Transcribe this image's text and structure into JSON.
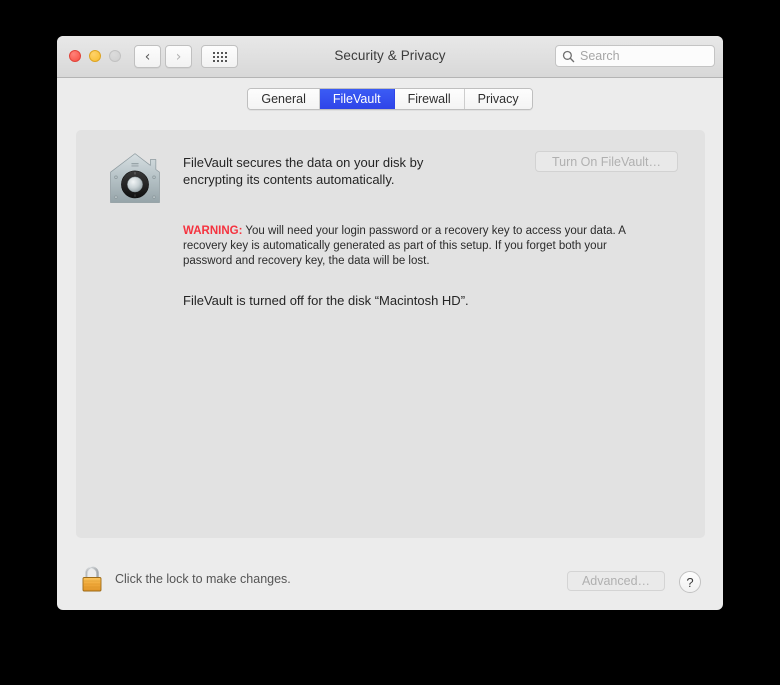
{
  "window": {
    "title": "Security & Privacy",
    "traffic_lights": [
      {
        "name": "close",
        "color": "#f74e43"
      },
      {
        "name": "minimize",
        "color": "#f7bd2e"
      },
      {
        "name": "zoom",
        "color": "#cfcfcf"
      }
    ],
    "nav": {
      "back_glyph": "‹",
      "forward_glyph": "›",
      "grid_name": "show-all-grid"
    },
    "search": {
      "placeholder": "Search",
      "value": "",
      "icon": "search-icon"
    }
  },
  "tabs": [
    {
      "label": "General",
      "selected": false
    },
    {
      "label": "FileVault",
      "selected": true
    },
    {
      "label": "Firewall",
      "selected": false
    },
    {
      "label": "Privacy",
      "selected": false
    }
  ],
  "content": {
    "icon": "filevault-safe-icon",
    "description": "FileVault secures the data on your disk by encrypting its contents automatically.",
    "turn_on_button": {
      "label": "Turn On FileVault…",
      "enabled": false
    },
    "warning": {
      "label": "WARNING:",
      "label_color": "#f5333f",
      "text": " You will need your login password or a recovery key to access your data. A recovery key is automatically generated as part of this setup. If you forget both your password and recovery key, the data will be lost."
    },
    "status": "FileVault is turned off for the disk “Macintosh HD”."
  },
  "footer": {
    "lock": {
      "icon": "lock-closed-icon",
      "label": "Click the lock to make changes."
    },
    "advanced_button": {
      "label": "Advanced…",
      "enabled": false
    },
    "help_button": {
      "label": "?"
    }
  },
  "colors": {
    "accent": "#3b5cf5",
    "warning": "#f5333f",
    "window_bg": "#ececec",
    "panel_bg": "#e2e2e2"
  }
}
